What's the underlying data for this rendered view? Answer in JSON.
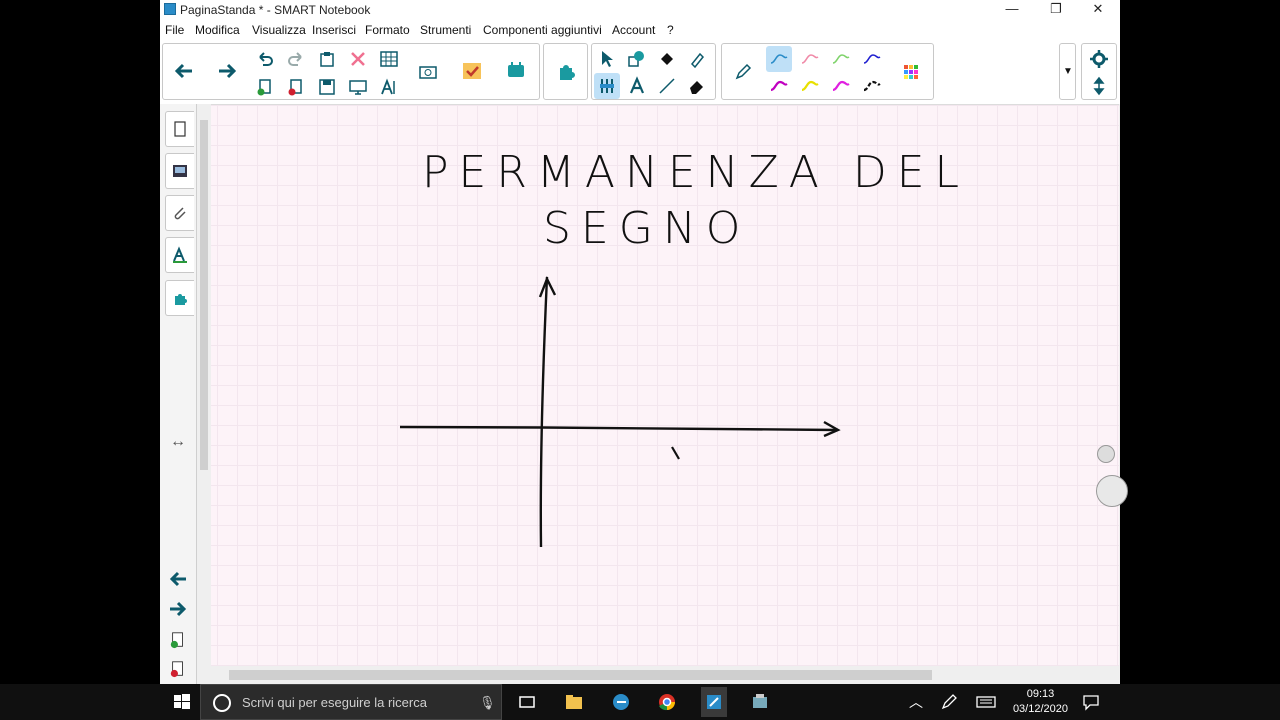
{
  "window": {
    "title": "PaginaStanda * - SMART Notebook",
    "controls": {
      "minimize": "—",
      "restore": "❐",
      "close": "✕"
    }
  },
  "menu": [
    "File",
    "Modifica",
    "Visualizza",
    "Inserisci",
    "Formato",
    "Strumenti",
    "Componenti aggiuntivi",
    "Account",
    "?"
  ],
  "toolbar": {
    "icons": [
      "back-arrow-icon",
      "forward-arrow-icon",
      "undo-icon",
      "redo-icon",
      "paste-icon",
      "delete-icon",
      "table-icon",
      "add-page-icon",
      "delete-page-icon",
      "save-icon",
      "screen-shade-icon",
      "text-tools-icon",
      "screen-capture-icon",
      "activity-icon",
      "response-icon",
      "addons-icon",
      "select-icon",
      "shapes-icon",
      "fill-icon",
      "eraser-pen-icon",
      "pen-icon",
      "text-icon",
      "line-icon",
      "eraser-icon"
    ],
    "colors": {
      "accent": "#2a8cc8",
      "teal": "#1a9aa0",
      "active_bg": "#bfe0f7"
    }
  },
  "pens": [
    {
      "color": "#2a8cc8"
    },
    {
      "color": "#f08aa8"
    },
    {
      "color": "#7fd36b"
    },
    {
      "color": "#2020d0"
    },
    {
      "color": "#c000c0"
    },
    {
      "color": "#e8e000"
    },
    {
      "color": "#e020e0"
    },
    {
      "color": "#111111"
    }
  ],
  "canvas": {
    "title_line1": "PERMANENZA DEL",
    "title_line2": "SEGNO"
  },
  "taskbar": {
    "search_placeholder": "Scrivi qui per eseguire la ricerca",
    "time": "09:13",
    "date": "03/12/2020"
  }
}
